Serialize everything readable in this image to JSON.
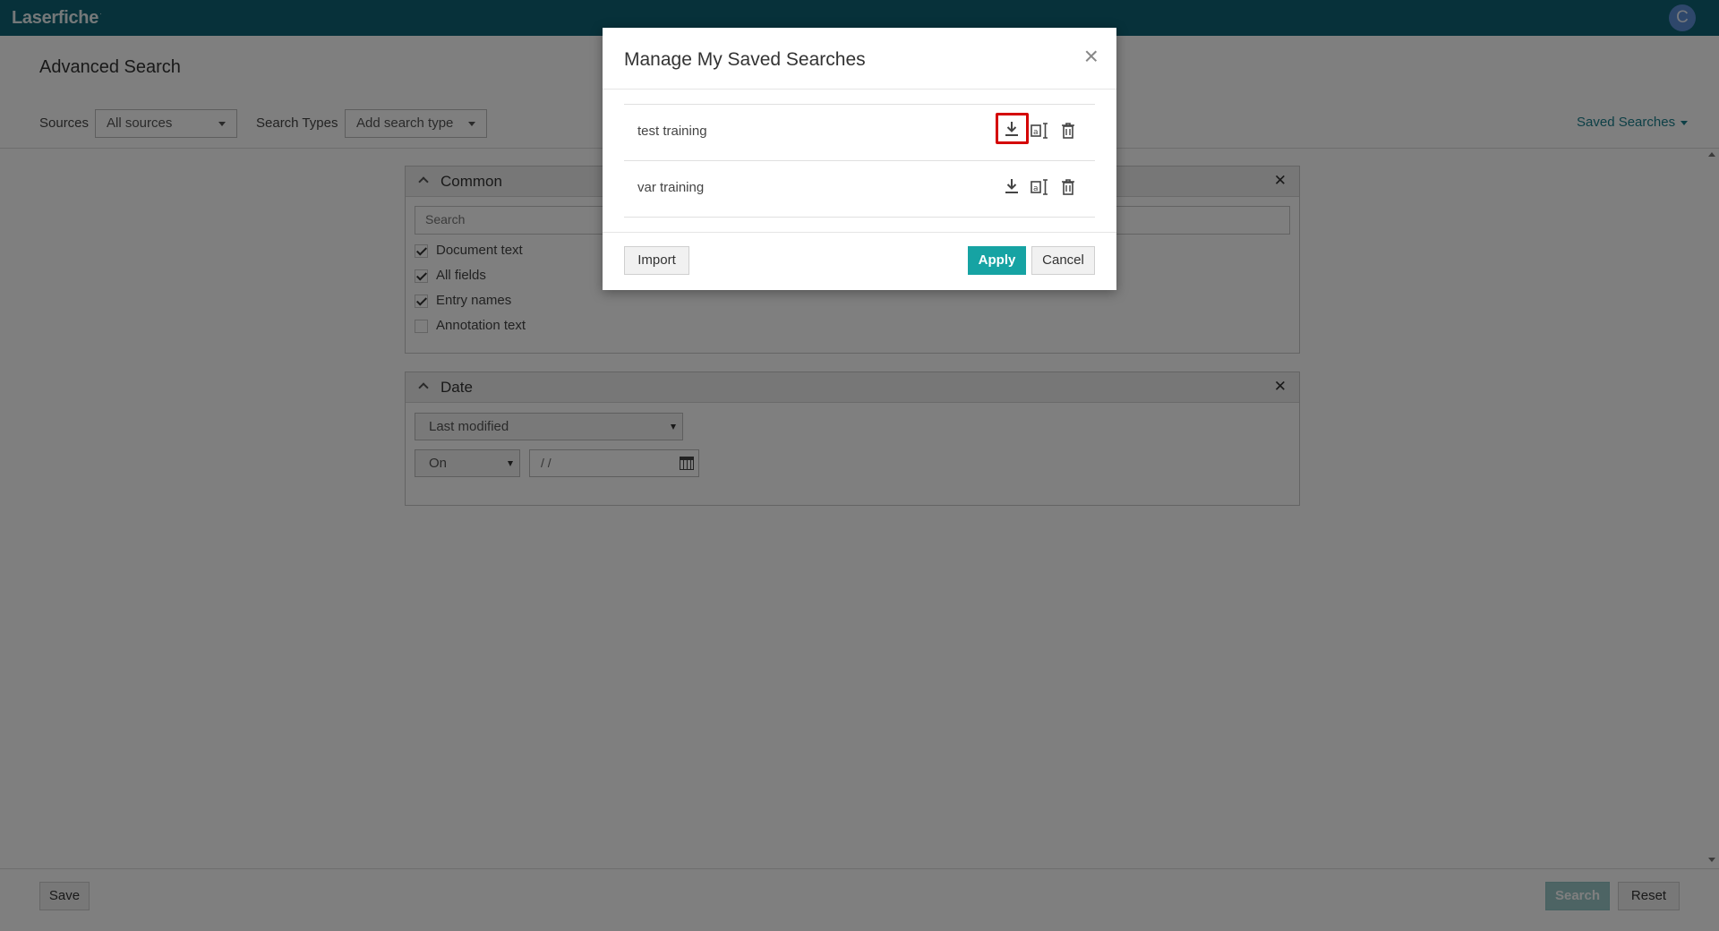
{
  "app": {
    "brand": "Laserfiche",
    "trademark": "·",
    "avatar_letter": "C"
  },
  "page": {
    "title": "Advanced Search",
    "sources_label": "Sources",
    "sources_value": "All sources",
    "search_types_label": "Search Types",
    "search_types_value": "Add search type",
    "saved_searches": "Saved Searches"
  },
  "common_panel": {
    "title": "Common",
    "search_placeholder": "Search",
    "options": [
      {
        "label": "Document text",
        "checked": true
      },
      {
        "label": "All fields",
        "checked": true
      },
      {
        "label": "Entry names",
        "checked": true
      },
      {
        "label": "Annotation text",
        "checked": false
      }
    ]
  },
  "date_panel": {
    "title": "Date",
    "field": "Last modified",
    "operator": "On",
    "date_value": "/  /"
  },
  "footer": {
    "save": "Save",
    "search": "Search",
    "reset": "Reset"
  },
  "modal": {
    "title": "Manage My Saved Searches",
    "close": "×",
    "items": [
      {
        "name": "test training"
      },
      {
        "name": "var training"
      }
    ],
    "import": "Import",
    "apply": "Apply",
    "cancel": "Cancel"
  },
  "colors": {
    "topbar": "#0e6374",
    "accent": "#16a3a3",
    "link": "#1a7f8c",
    "highlight": "#d40000"
  }
}
